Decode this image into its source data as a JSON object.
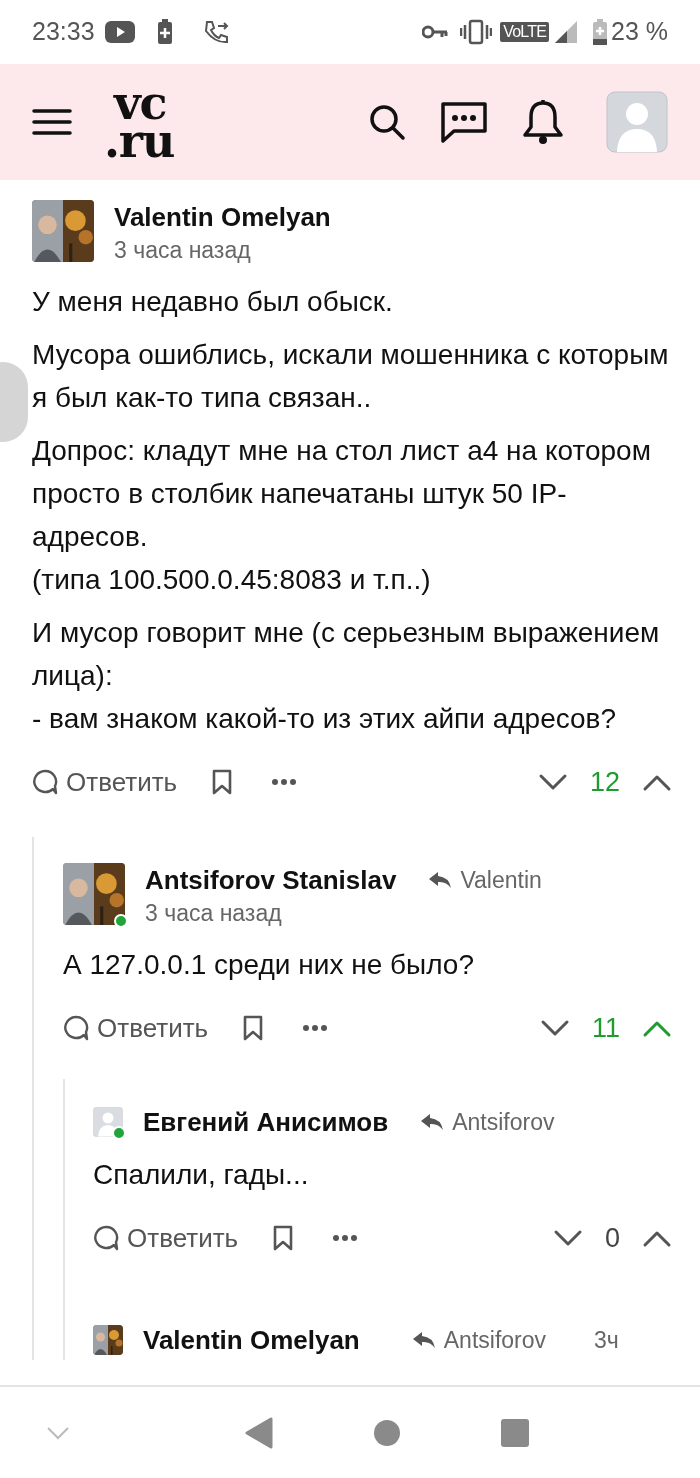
{
  "status_bar": {
    "time": "23:33",
    "network_badge": "VoLTE",
    "battery": "23 %"
  },
  "header": {
    "logo": [
      "vc",
      ".ru"
    ]
  },
  "comments": [
    {
      "author": "Valentin Omelyan",
      "has_photo": true,
      "online": false,
      "compact": false,
      "time": "3 часа назад",
      "paragraphs": [
        "У меня недавно был обыск.",
        "Мусора ошиблись, искали мошенника с которым я был как-то типа связан..",
        "Допрос: кладут мне на стол лист а4 на котором просто в столбик напечатаны штук 50 IP-адресов.\n(типа 100.500.0.45:8083 и т.п..)",
        "И мусор говорит мне (с серьезным выражением лица):\n- вам знаком какой-то из этих айпи адресов?"
      ],
      "reply_label": "Ответить",
      "score": "12",
      "positive": true,
      "upvoted": false,
      "children": [
        {
          "author": "Antsiforov Stanislav",
          "reply_to": "Valentin",
          "has_photo": true,
          "online": true,
          "compact": false,
          "time": "3 часа назад",
          "paragraphs": [
            "А 127.0.0.1 среди них не было?"
          ],
          "reply_label": "Ответить",
          "score": "11",
          "positive": true,
          "upvoted": true,
          "children": [
            {
              "author": "Евгений Анисимов",
              "reply_to": "Antsiforov",
              "has_photo": false,
              "online": true,
              "compact": false,
              "paragraphs": [
                "Спалили, гады..."
              ],
              "reply_label": "Ответить",
              "score": "0",
              "positive": false,
              "upvoted": false
            },
            {
              "author": "Valentin Omelyan",
              "reply_to": "Antsiforov",
              "has_photo": true,
              "online": false,
              "compact": true,
              "time": "3ч"
            }
          ]
        }
      ]
    }
  ]
}
